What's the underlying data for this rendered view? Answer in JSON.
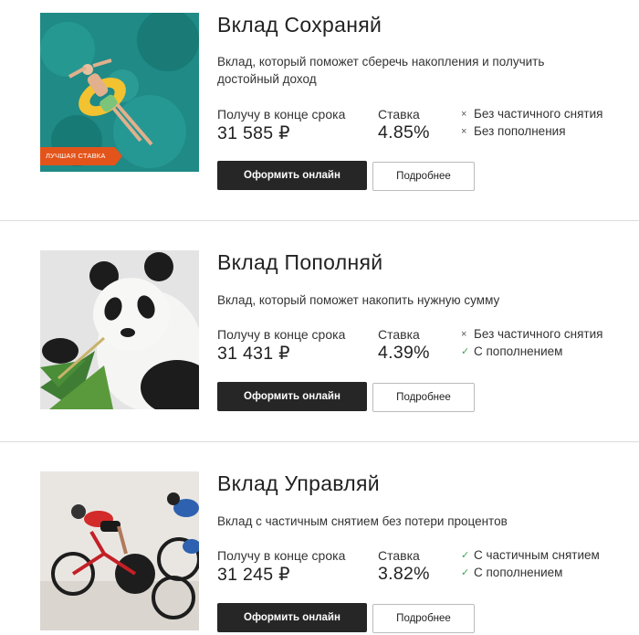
{
  "deposits": [
    {
      "title": "Вклад Сохраняй",
      "description": "Вклад, который поможет сберечь накопления и получить достойный доход",
      "badge": "Лучшая ставка",
      "receive_label": "Получу в конце срока",
      "receive_value": "31 585 ₽",
      "rate_label": "Ставка",
      "rate_value": "4.85%",
      "features": [
        {
          "icon": "cross-icon",
          "mark": "×",
          "text": "Без частичного снятия"
        },
        {
          "icon": "cross-icon",
          "mark": "×",
          "text": "Без пополнения"
        }
      ],
      "apply_label": "Оформить онлайн",
      "more_label": "Подробнее"
    },
    {
      "title": "Вклад Пополняй",
      "description": "Вклад, который поможет накопить нужную сумму",
      "receive_label": "Получу в конце срока",
      "receive_value": "31 431 ₽",
      "rate_label": "Ставка",
      "rate_value": "4.39%",
      "features": [
        {
          "icon": "cross-icon",
          "mark": "×",
          "text": "Без частичного снятия"
        },
        {
          "icon": "check-icon",
          "mark": "✓",
          "text": "С пополнением"
        }
      ],
      "apply_label": "Оформить онлайн",
      "more_label": "Подробнее"
    },
    {
      "title": "Вклад Управляй",
      "description": "Вклад с частичным снятием без потери процентов",
      "receive_label": "Получу в конце срока",
      "receive_value": "31 245 ₽",
      "rate_label": "Ставка",
      "rate_value": "3.82%",
      "features": [
        {
          "icon": "check-icon",
          "mark": "✓",
          "text": "С частичным снятием"
        },
        {
          "icon": "check-icon",
          "mark": "✓",
          "text": "С пополнением"
        }
      ],
      "apply_label": "Оформить онлайн",
      "more_label": "Подробнее"
    }
  ],
  "colors": {
    "badge": "#e3541b",
    "button_dark": "#262626",
    "check": "#3aa853",
    "divider": "#dcdcdc"
  }
}
